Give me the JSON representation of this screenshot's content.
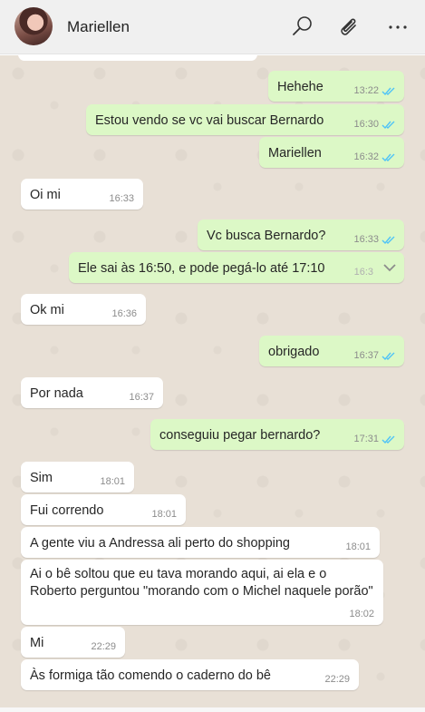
{
  "contact": {
    "name": "Mariellen"
  },
  "icons": {
    "search": "search-icon",
    "attach": "paperclip-icon",
    "menu": "more-icon"
  },
  "colors": {
    "outgoing_bubble": "#dcf8c6",
    "incoming_bubble": "#ffffff",
    "read_ticks": "#4fc3f7",
    "chat_bg": "#e8e0d6"
  },
  "messages": [
    {
      "dir": "out",
      "text": "Hehehe",
      "time": "13:22"
    },
    {
      "dir": "out",
      "text": "Estou vendo se vc vai buscar Bernardo",
      "time": "16:30"
    },
    {
      "dir": "out",
      "text": "Mariellen",
      "time": "16:32"
    },
    {
      "dir": "in",
      "text": "Oi mi",
      "time": "16:33"
    },
    {
      "dir": "out",
      "text": "Vc busca Bernardo?",
      "time": "16:33"
    },
    {
      "dir": "out",
      "text": "Ele sai às 16:50, e pode pegá-lo até 17:10",
      "time": "16:3"
    },
    {
      "dir": "in",
      "text": "Ok mi",
      "time": "16:36"
    },
    {
      "dir": "out",
      "text": "obrigado",
      "time": "16:37"
    },
    {
      "dir": "in",
      "text": "Por nada",
      "time": "16:37"
    },
    {
      "dir": "out",
      "text": "conseguiu pegar bernardo?",
      "time": "17:31"
    },
    {
      "dir": "in",
      "text": "Sim",
      "time": "18:01"
    },
    {
      "dir": "in",
      "text": "Fui correndo",
      "time": "18:01"
    },
    {
      "dir": "in",
      "text": "A gente viu a Andressa ali perto do shopping",
      "time": "18:01"
    },
    {
      "dir": "in",
      "text": "Ai o bê soltou que eu tava morando aqui, ai ela e o Roberto perguntou \"morando com o Michel naquele porão\"",
      "time": "18:02"
    },
    {
      "dir": "in",
      "text": "Mi",
      "time": "22:29"
    },
    {
      "dir": "in",
      "text": "Às formiga tão comendo o caderno do bê",
      "time": "22:29"
    }
  ]
}
